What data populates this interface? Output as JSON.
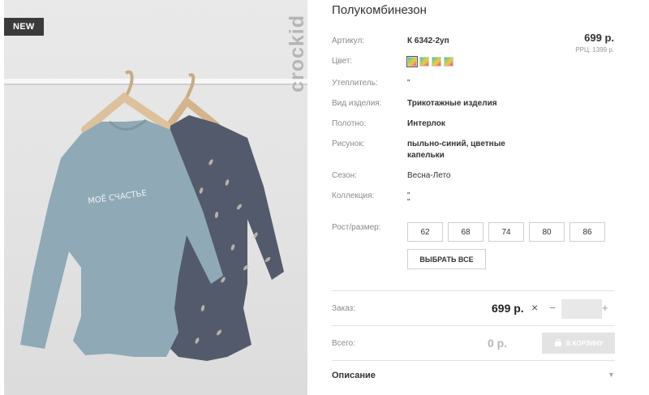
{
  "product": {
    "badge": "NEW",
    "brand": "crockid",
    "title": "Полукомбинезон",
    "price": "699 р.",
    "rrp": "РРЦ: 1399 р."
  },
  "specs": {
    "article_label": "Артикул:",
    "article_value": "К 6342-2уп",
    "color_label": "Цвет:",
    "insulation_label": "Утеплитель:",
    "insulation_value": "\"",
    "type_label": "Вид изделия:",
    "type_value": "Трикотажные изделия",
    "fabric_label": "Полотно:",
    "fabric_value": "Интерлок",
    "pattern_label": "Рисунок:",
    "pattern_line1": "пыльно-синий, цветные",
    "pattern_line2": "капельки",
    "season_label": "Сезон:",
    "season_value": "Весна-Лето",
    "collection_label": "Коллекция:",
    "collection_line1": "\"",
    "collection_line2": "\"",
    "size_label": "Рост/размер:"
  },
  "swatches": [
    {
      "name": "swatch-1",
      "selected": true
    },
    {
      "name": "swatch-2",
      "selected": false
    },
    {
      "name": "swatch-3",
      "selected": false
    },
    {
      "name": "swatch-4",
      "selected": false
    }
  ],
  "sizes": [
    "62",
    "68",
    "74",
    "80",
    "86"
  ],
  "select_all_label": "ВЫБРАТЬ ВСЕ",
  "order": {
    "label": "Заказ:",
    "price": "699 р.",
    "times": "×",
    "minus": "−",
    "plus": "+",
    "quantity": ""
  },
  "total": {
    "label": "Всего:",
    "value": "0 р.",
    "cart_label": "В КОРЗИНУ"
  },
  "description_label": "Описание",
  "photo_print_text": "МОЁ СЧАСТЬЕ",
  "colors": {
    "body_light": "#8fa9b7",
    "body_dark": "#4f5567",
    "hanger": "#d8bd9a"
  }
}
